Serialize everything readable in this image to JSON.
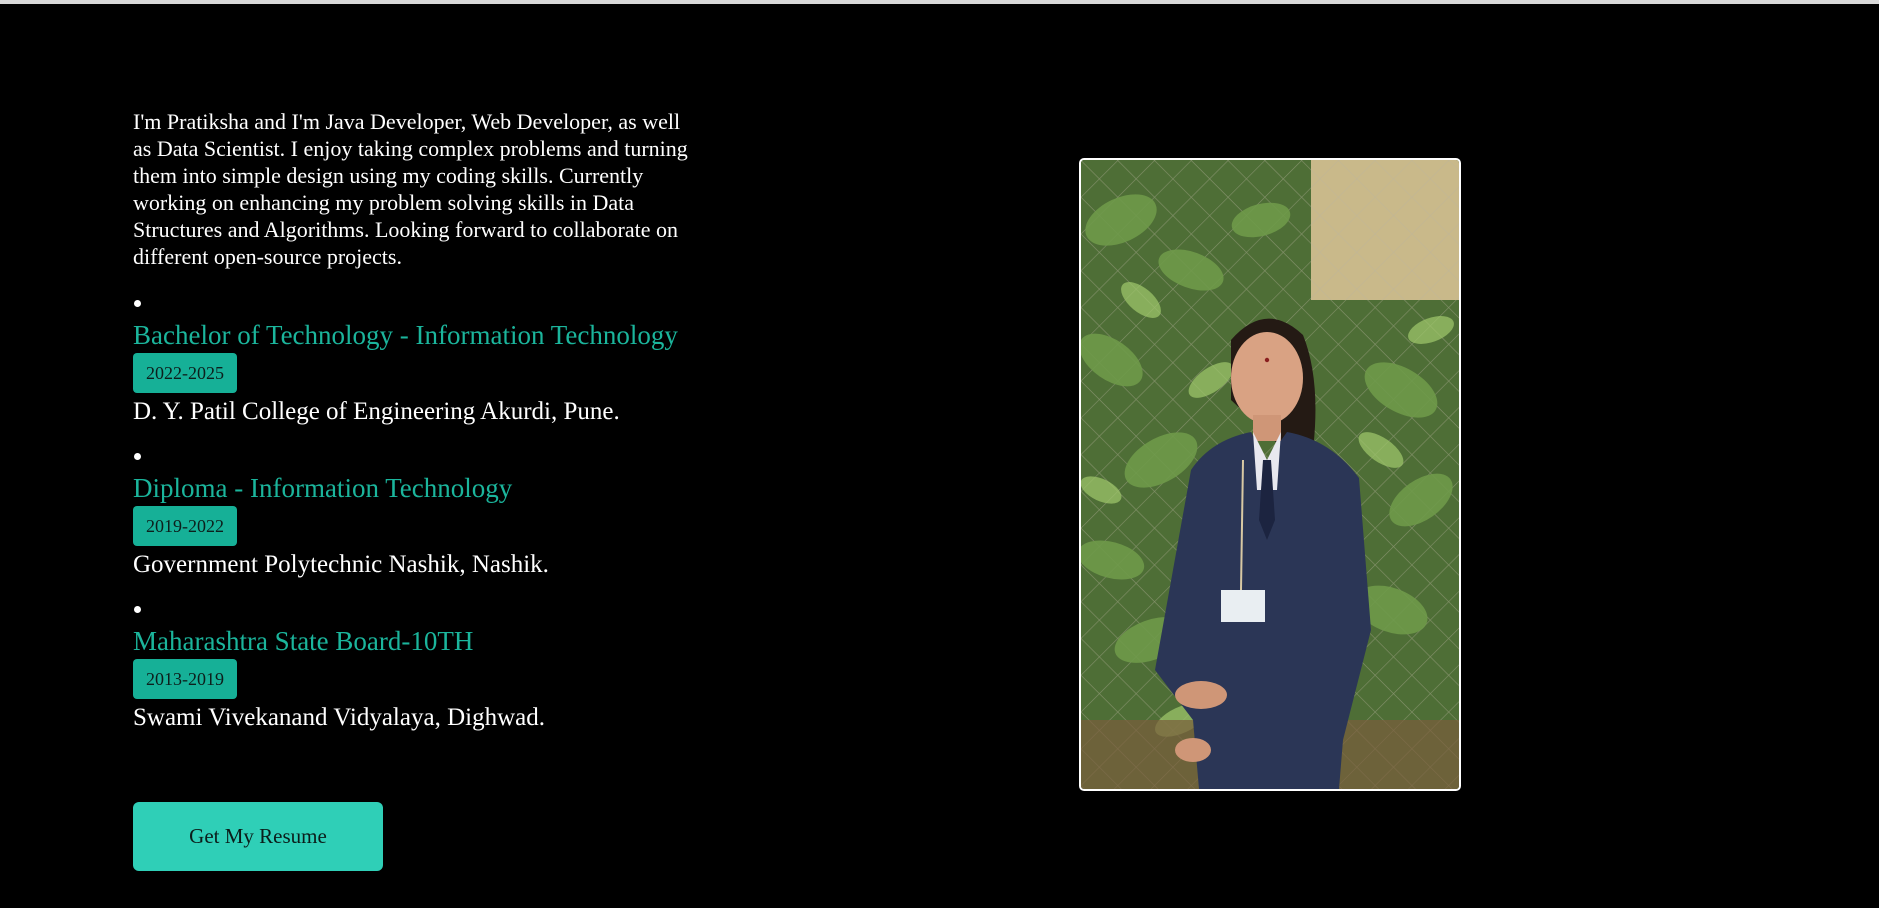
{
  "about": {
    "intro": "I'm Pratiksha and I'm Java Developer, Web Developer, as well as Data Scientist. I enjoy taking complex problems and turning them into simple design using my coding skills. Currently working on enhancing my problem solving skills in Data Structures and Algorithms. Looking forward to collaborate on different open-source projects."
  },
  "education": [
    {
      "title": "Bachelor of Technology - Information Technology",
      "years": "2022-2025",
      "school": "D. Y. Patil College of Engineering Akurdi, Pune."
    },
    {
      "title": "Diploma - Information Technology",
      "years": "2019-2022",
      "school": "Government Polytechnic Nashik, Nashik."
    },
    {
      "title": "Maharashtra State Board-10TH",
      "years": "2013-2019",
      "school": "Swami Vivekanand Vidyalaya, Dighwad."
    }
  ],
  "resume_button": {
    "label": "Get My Resume"
  },
  "colors": {
    "background": "#000000",
    "accent": "#1bb59c",
    "button": "#2fcfb7"
  }
}
